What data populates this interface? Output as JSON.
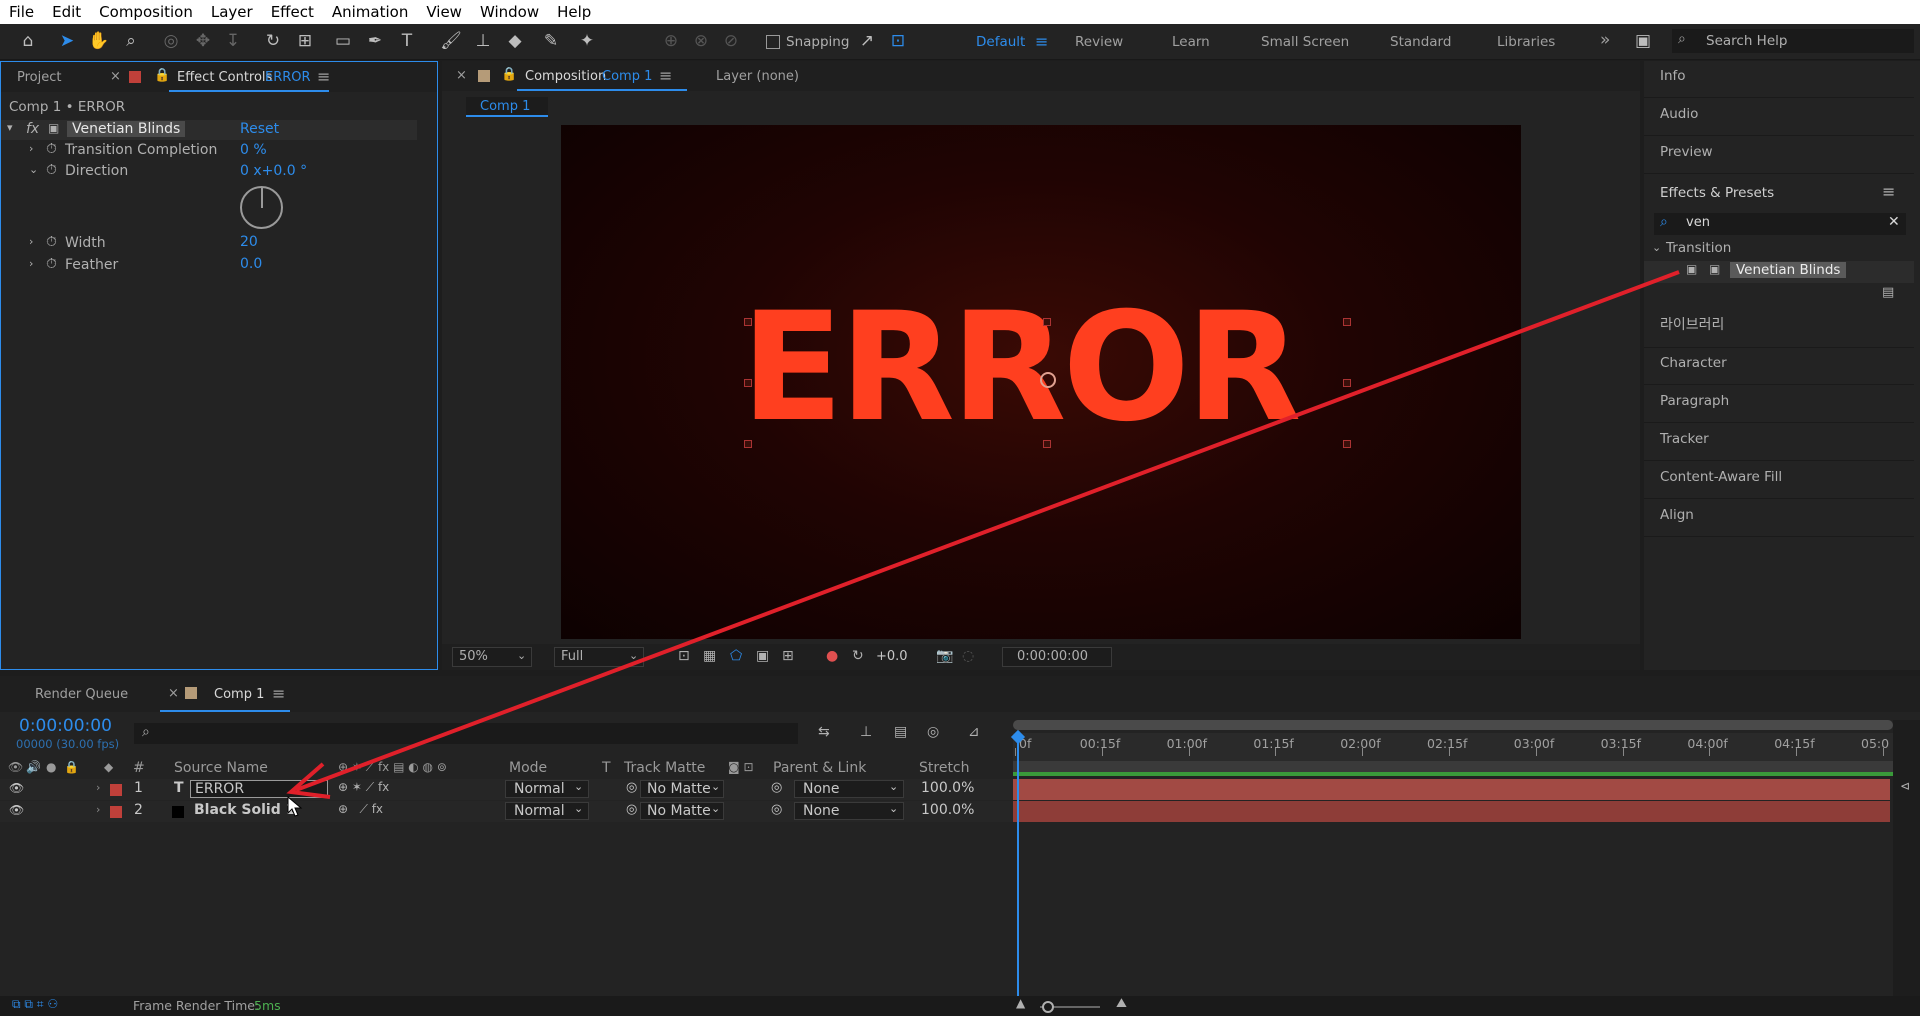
{
  "menu": [
    "File",
    "Edit",
    "Composition",
    "Layer",
    "Effect",
    "Animation",
    "View",
    "Window",
    "Help"
  ],
  "toolbar": {
    "snapping": "Snapping",
    "search_placeholder": "Search Help"
  },
  "workspaces": [
    "Default",
    "Review",
    "Learn",
    "Small Screen",
    "Standard",
    "Libraries"
  ],
  "left_panel": {
    "tab_project": "Project",
    "tab_effect_controls": "Effect Controls",
    "tab_effect_controls_layer": "ERROR",
    "breadcrumb": "Comp 1 • ERROR",
    "effect_name": "Venetian Blinds",
    "reset": "Reset",
    "params": [
      {
        "label": "Transition Completion",
        "value": "0 %"
      },
      {
        "label": "Direction",
        "value": "0 x+0.0 °"
      },
      {
        "label": "Width",
        "value": "20"
      },
      {
        "label": "Feather",
        "value": "0.0"
      }
    ]
  },
  "composition": {
    "tab_label": "Composition",
    "tab_comp": "Comp 1",
    "layer_tab": "Layer (none)",
    "sub_tab": "Comp 1",
    "text": "ERROR",
    "zoom": "50%",
    "resolution": "Full",
    "exposure": "+0.0",
    "timecode": "0:00:00:00",
    "colors": {
      "bg": "#140302",
      "text": "#ff3f1f"
    }
  },
  "right_panel": {
    "items_top": [
      "Info",
      "Audio",
      "Preview"
    ],
    "effects_title": "Effects & Presets",
    "search_value": "ven",
    "group": "Transition",
    "result": "Venetian Blinds",
    "items_bottom": [
      "라이브러리",
      "Character",
      "Paragraph",
      "Tracker",
      "Content-Aware Fill",
      "Align"
    ]
  },
  "timeline": {
    "tab_render_queue": "Render Queue",
    "tab_comp": "Comp 1",
    "timecode": "0:00:00:00",
    "frame_info": "00000 (30.00 fps)",
    "headers": {
      "num": "#",
      "source": "Source Name",
      "mode": "Mode",
      "t": "T",
      "track_matte": "Track Matte",
      "parent": "Parent & Link",
      "stretch": "Stretch"
    },
    "layers": [
      {
        "num": "1",
        "type": "T",
        "name": "ERROR",
        "mode": "Normal",
        "matte": "No Matte",
        "parent": "None",
        "stretch": "100.0%",
        "color": "#c0403a"
      },
      {
        "num": "2",
        "type": "",
        "name": "Black Solid 1",
        "mode": "Normal",
        "matte": "No Matte",
        "parent": "None",
        "stretch": "100.0%",
        "color": "#c0403a"
      }
    ],
    "ruler": [
      "0f",
      "00:15f",
      "01:00f",
      "01:15f",
      "02:00f",
      "02:15f",
      "03:00f",
      "03:15f",
      "04:00f",
      "04:15f",
      "05:0"
    ],
    "render_time_label": "Frame Render Time:",
    "render_time_value": "5ms"
  }
}
